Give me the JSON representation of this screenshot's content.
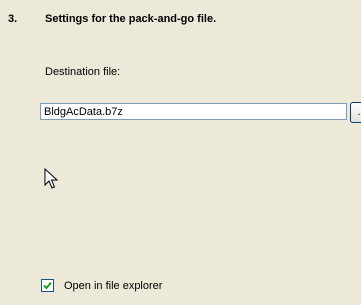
{
  "step": {
    "number": "3.",
    "title": "Settings for the pack-and-go file."
  },
  "destination": {
    "label": "Destination file:",
    "value": "BldgAcData.b7z",
    "browse_label": "..."
  },
  "options": {
    "open_in_explorer": {
      "label": "Open in file explorer",
      "checked": true
    }
  },
  "icons": {
    "cursor": "arrow-cursor-icon",
    "checkmark": "checkmark-icon"
  },
  "colors": {
    "background": "#ece9d8",
    "input_border": "#7f9db9",
    "checkbox_border": "#1c5180",
    "checkmark": "#21a121"
  }
}
